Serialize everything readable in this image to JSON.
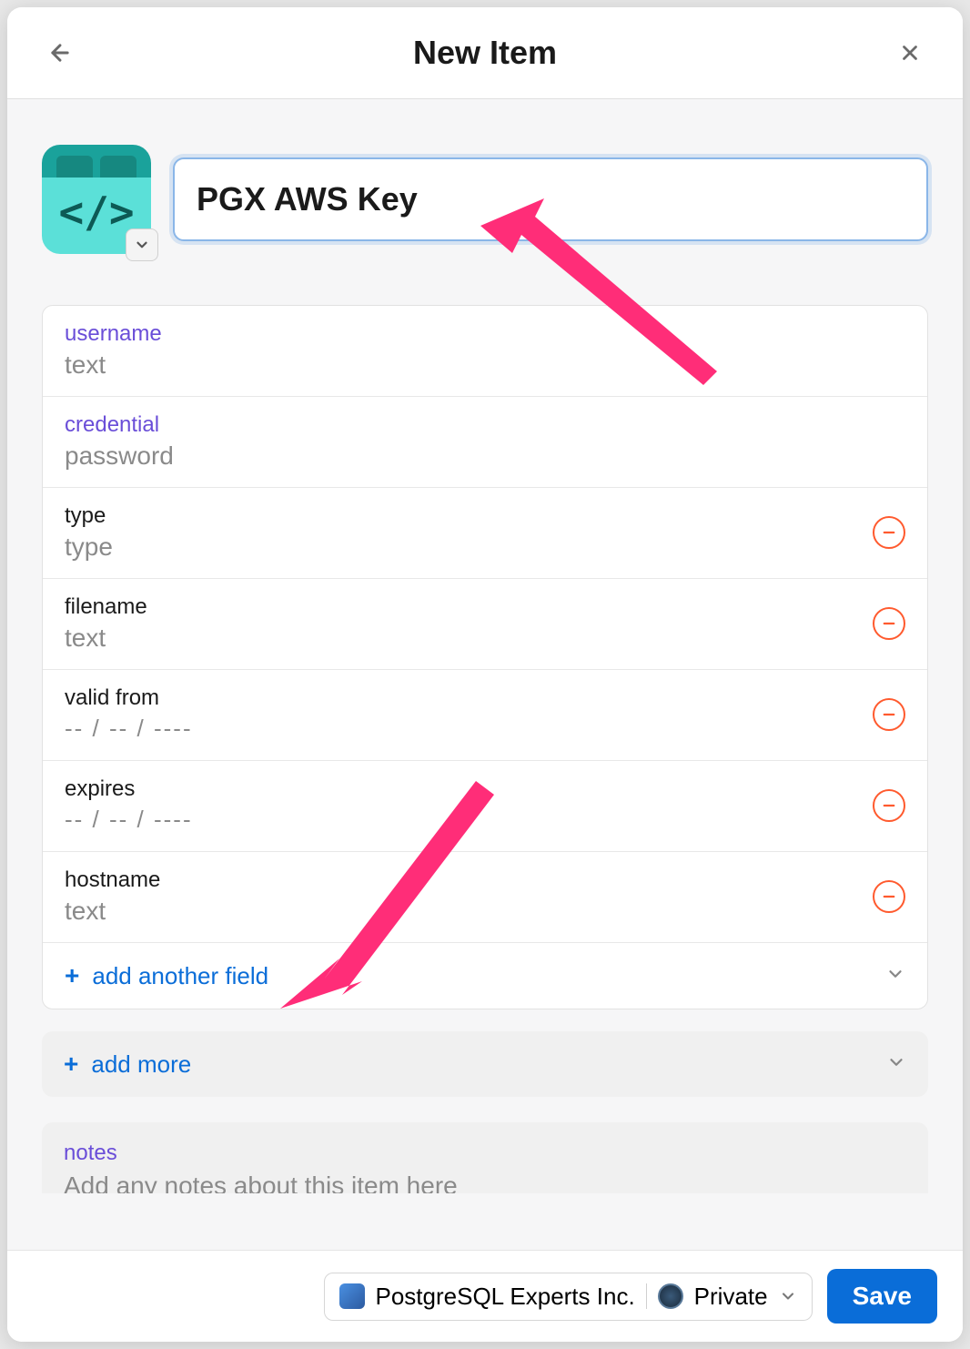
{
  "header": {
    "title": "New Item"
  },
  "item": {
    "title_value": "PGX AWS Key",
    "icon_code": "</>"
  },
  "fields": [
    {
      "label": "username",
      "placeholder": "text",
      "purple": true,
      "removable": false,
      "date": false
    },
    {
      "label": "credential",
      "placeholder": "password",
      "purple": true,
      "removable": false,
      "date": false
    },
    {
      "label": "type",
      "placeholder": "type",
      "purple": false,
      "removable": true,
      "date": false
    },
    {
      "label": "filename",
      "placeholder": "text",
      "purple": false,
      "removable": true,
      "date": false
    },
    {
      "label": "valid from",
      "placeholder": "--  /  --  /  ----",
      "purple": false,
      "removable": true,
      "date": true
    },
    {
      "label": "expires",
      "placeholder": "--  /  --  /  ----",
      "purple": false,
      "removable": true,
      "date": true
    },
    {
      "label": "hostname",
      "placeholder": "text",
      "purple": false,
      "removable": true,
      "date": false
    }
  ],
  "actions": {
    "add_another_field": "add another field",
    "add_more": "add more"
  },
  "notes": {
    "label": "notes",
    "placeholder": "Add any notes about this item here"
  },
  "footer": {
    "account": "PostgreSQL Experts Inc.",
    "vault": "Private",
    "save_label": "Save"
  }
}
